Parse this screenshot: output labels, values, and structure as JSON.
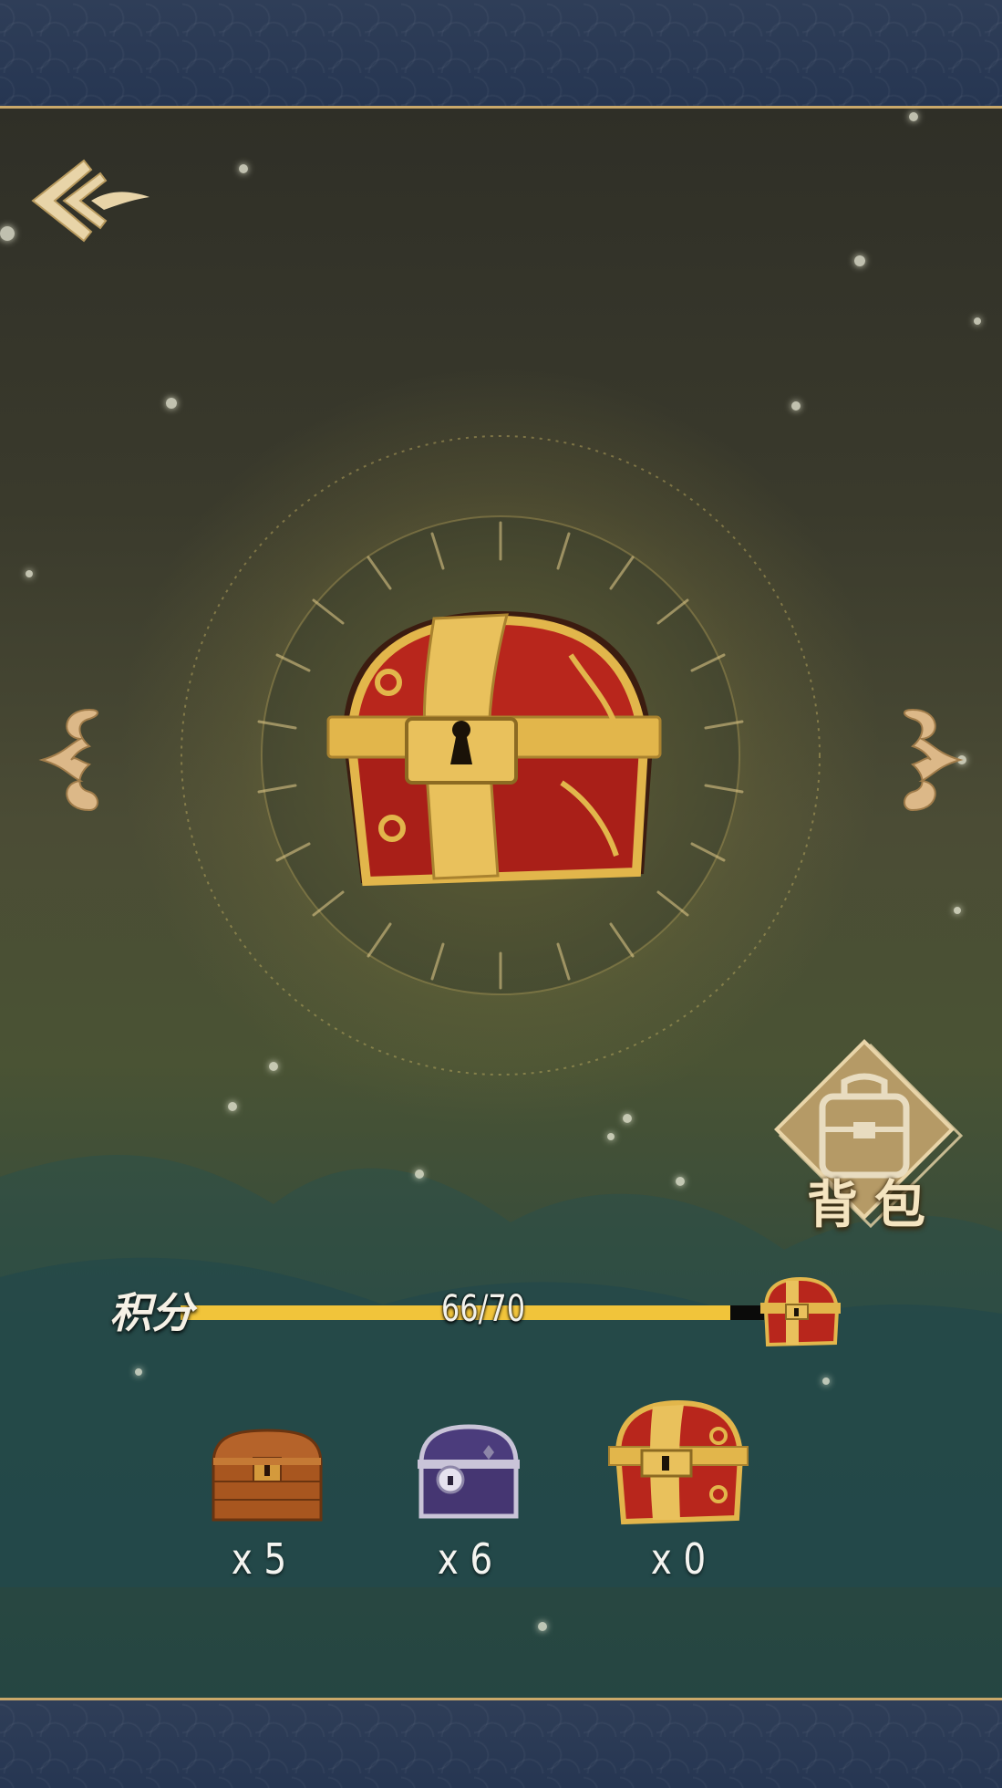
{
  "score": {
    "label": "积分",
    "current": 66,
    "max": 70,
    "display": "66/70",
    "fill_color": "#f1c43a"
  },
  "backpack": {
    "label": "背包",
    "icon": "backpack-icon"
  },
  "navigation": {
    "back_icon": "back-arrow-icon",
    "prev_icon": "left-scroll-arrow-icon",
    "next_icon": "right-scroll-arrow-icon"
  },
  "featured_chest": {
    "icon": "red-gold-treasure-chest-icon"
  },
  "inventory": [
    {
      "icon": "wooden-chest-icon",
      "count_text": "x 5"
    },
    {
      "icon": "purple-chest-icon",
      "count_text": "x 6"
    },
    {
      "icon": "red-gold-chest-icon",
      "count_text": "x 0"
    }
  ],
  "colors": {
    "gold": "#c9a86a",
    "banner": "#2f3e58",
    "chest_red": "#b8261c",
    "chest_gold": "#e2b64b"
  }
}
